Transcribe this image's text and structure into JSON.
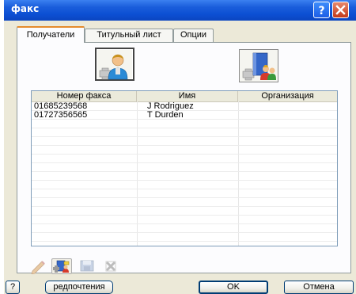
{
  "window": {
    "title": "факс"
  },
  "titlebar": {
    "help_label": "?",
    "help_icon": "help-icon",
    "close_icon": "close-icon"
  },
  "tabs": [
    {
      "label": "Получатели",
      "active": true
    },
    {
      "label": "Титульный лист",
      "active": false
    },
    {
      "label": "Опции",
      "active": false
    }
  ],
  "top_buttons": [
    {
      "icon": "add-recipient-person-icon"
    },
    {
      "icon": "add-from-address-book-icon"
    }
  ],
  "list": {
    "columns": [
      "Номер факса",
      "Имя",
      "Организация"
    ],
    "rows": [
      {
        "fax": "01685239568",
        "name": "J Rodriguez",
        "org": ""
      },
      {
        "fax": "01727356565",
        "name": "T Durden",
        "org": ""
      }
    ]
  },
  "toolbar": [
    {
      "icon": "edit-pencil-icon",
      "enabled": false
    },
    {
      "icon": "add-to-address-book-icon",
      "enabled": true
    },
    {
      "icon": "save-to-address-book-icon",
      "enabled": false
    },
    {
      "icon": "delete-icon",
      "enabled": false
    }
  ],
  "footer": {
    "help_label": "?",
    "preferences_label": "редпочтения",
    "ok_label": "OK",
    "cancel_label": "Отмена"
  },
  "colors": {
    "titlebar": "#0c4fd3",
    "dialog_bg": "#ece9d8",
    "tab_accent": "#e68b2c",
    "close_button": "#c4391a"
  }
}
